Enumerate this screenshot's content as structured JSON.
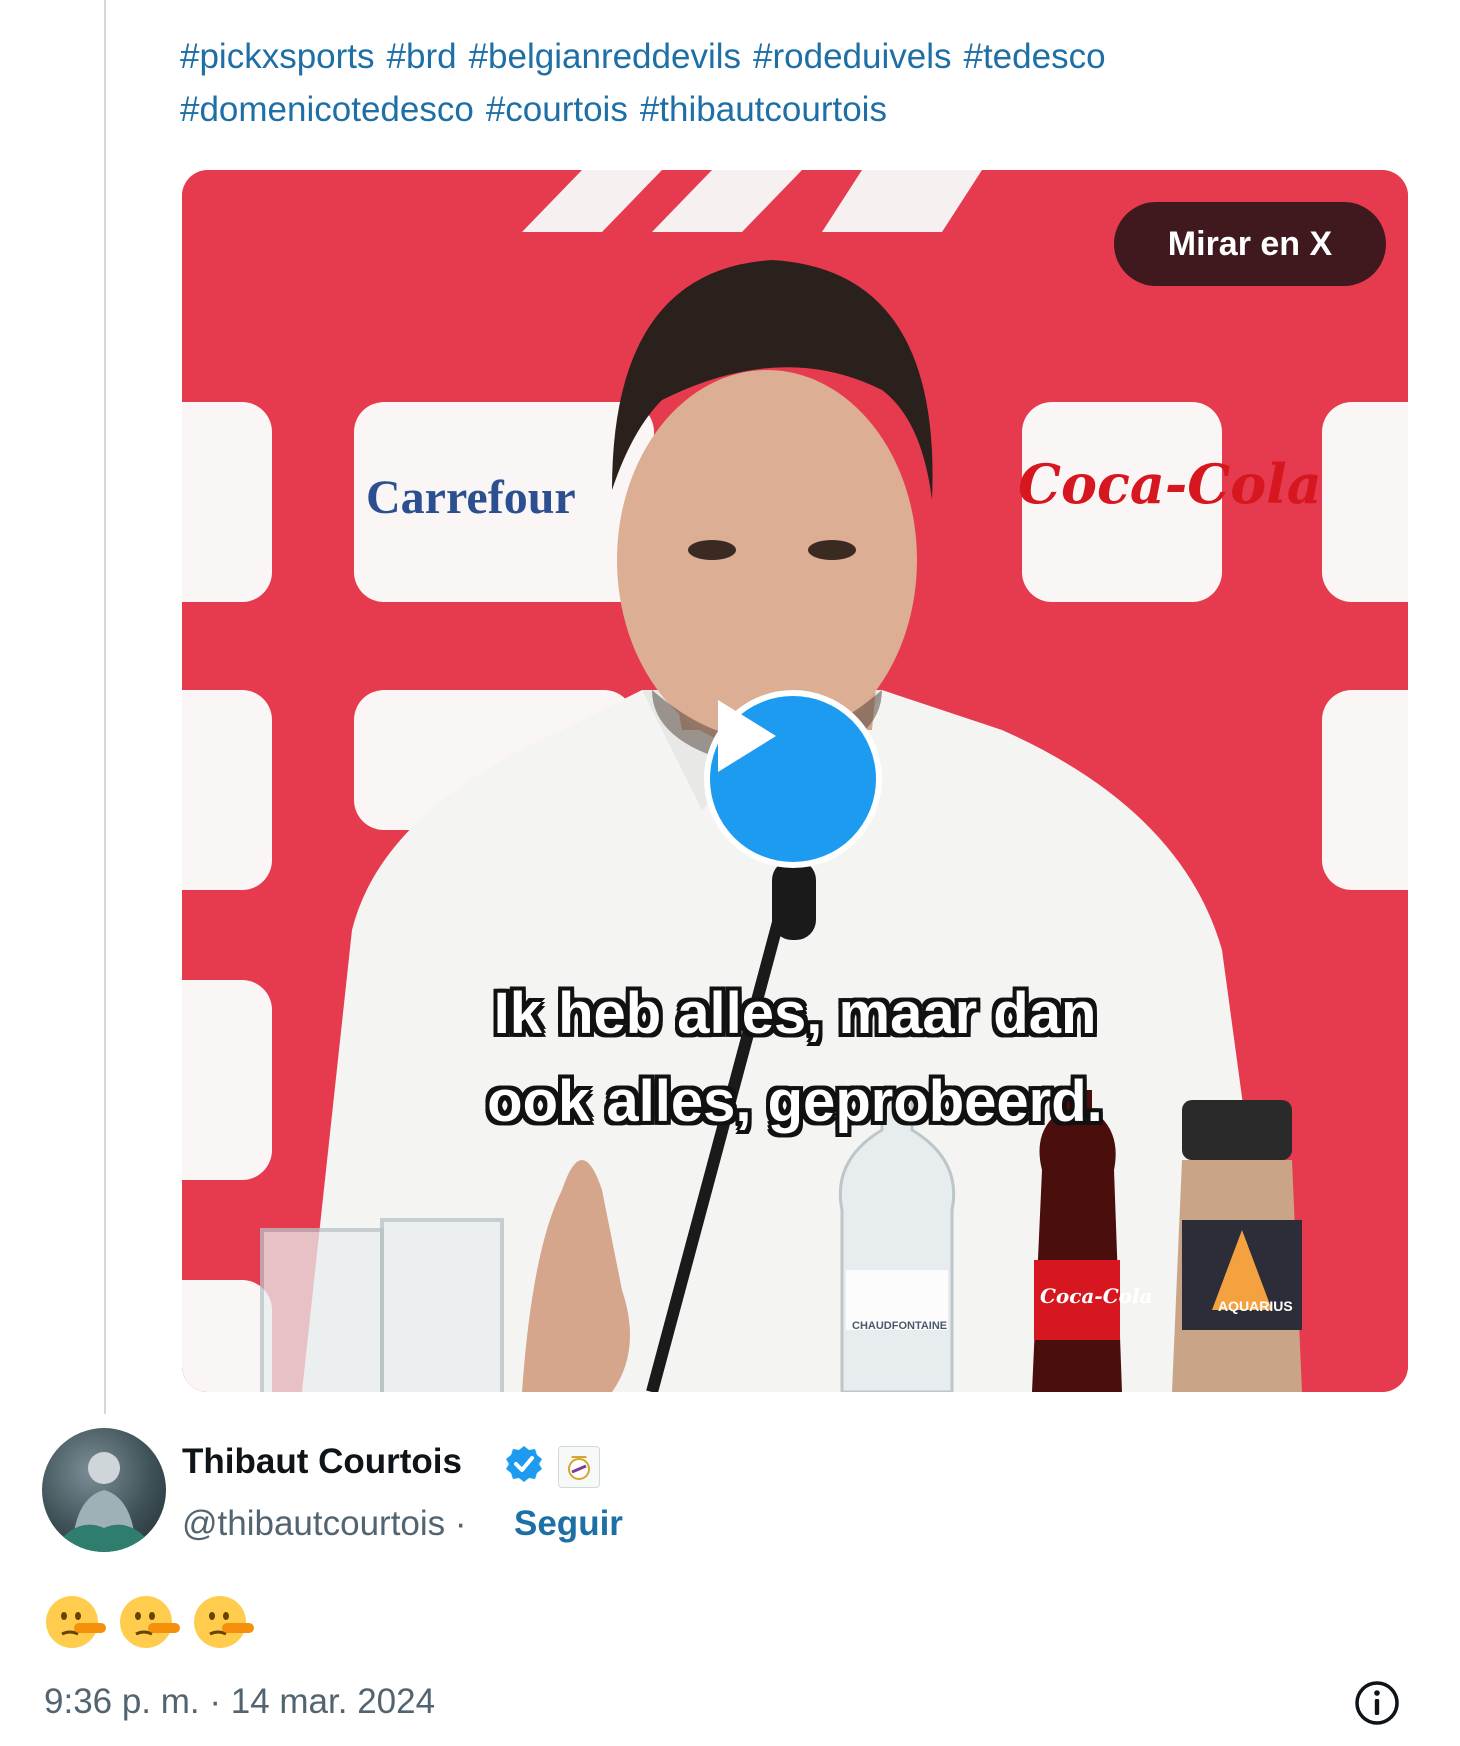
{
  "post": {
    "hashtags": [
      "#pickxsports",
      "#brd",
      "#belgianreddevils",
      "#rodeduivels",
      "#tedesco",
      "#domenicotedesco",
      "#courtois",
      "#thibautcourtois"
    ]
  },
  "media": {
    "watch_label": "Mirar en X",
    "subtitle_line1": "Ik heb alles, maar dan",
    "subtitle_line2": "ook alles, geprobeerd.",
    "sponsors": [
      "Carrefour",
      "Coca-Cola"
    ],
    "bottle_labels": [
      "CHAUDFONTAINE",
      "Coca-Cola",
      "AQUARIUS"
    ],
    "play_icon": "play-icon"
  },
  "reply": {
    "author_name": "Thibaut Courtois",
    "handle": "@thibautcourtois",
    "separator": "·",
    "follow_label": "Seguir",
    "verified_icon": "verified-badge-icon",
    "affiliation_icon": "real-madrid-crest-icon",
    "emoji_count": 3,
    "emoji_name": "lying-face-emoji",
    "timestamp": "9:36 p. m. · 14 mar. 2024",
    "info_icon": "info-icon"
  },
  "colors": {
    "link": "#1d6fa5",
    "accent": "#1d9bf0",
    "backdrop_red": "#e63b4f"
  }
}
